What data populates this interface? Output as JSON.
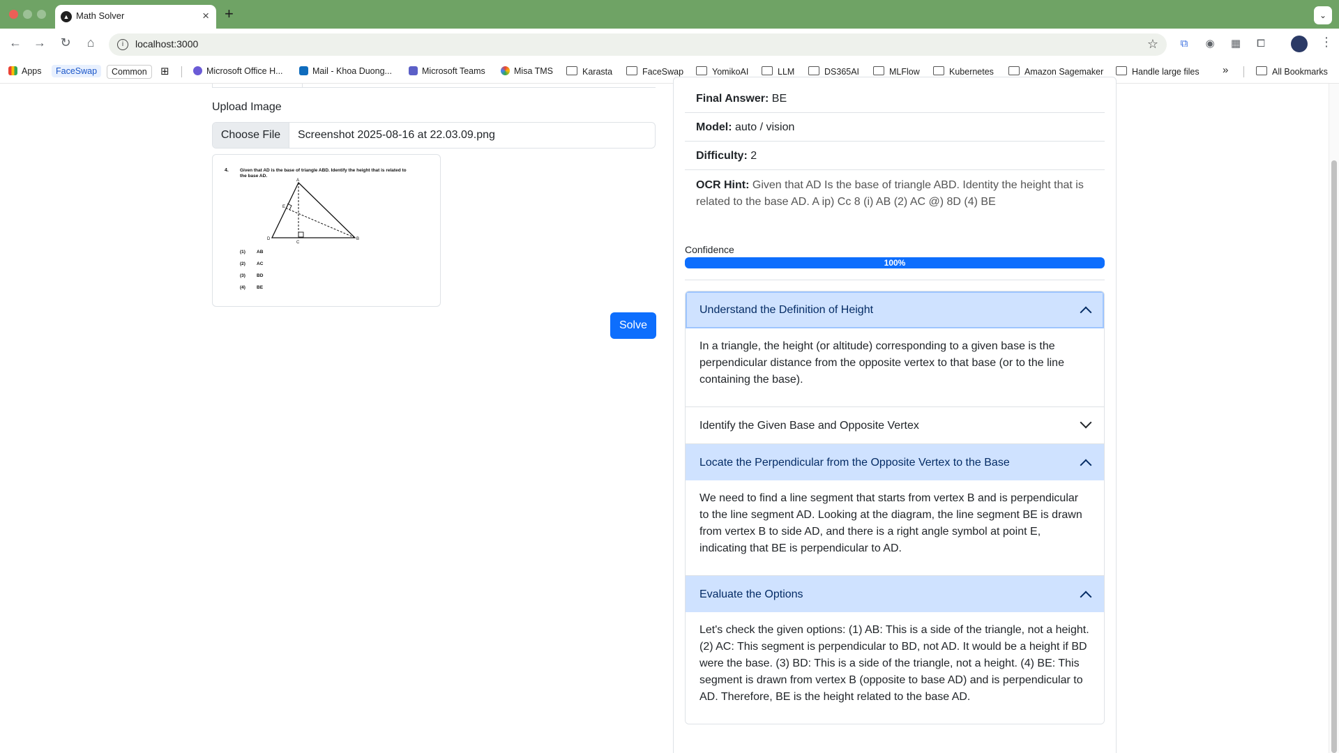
{
  "browser": {
    "tab_title": "Math Solver",
    "url": "localhost:3000",
    "bookmarks": [
      "Apps",
      "FaceSwap",
      "Common",
      "Microsoft Office H...",
      "Mail - Khoa Duong...",
      "Microsoft Teams",
      "Misa TMS",
      "Karasta",
      "FaceSwap",
      "YomikoAI",
      "LLM",
      "DS365AI",
      "MLFlow",
      "Kubernetes",
      "Amazon Sagemaker",
      "Handle large files"
    ],
    "all_bookmarks": "All Bookmarks",
    "overflow": "»"
  },
  "left": {
    "upload_label": "Upload Image",
    "choose_file": "Choose File",
    "file_name": "Screenshot 2025-08-16 at 22.03.09.png",
    "solve": "Solve",
    "preview": {
      "number": "4.",
      "question_line1": "Given that AD is the base of triangle ABD. Identify the height that is related to",
      "question_line2": "the base AD.",
      "labels": {
        "A": "A",
        "B": "B",
        "C": "C",
        "D": "D",
        "E": "E"
      },
      "options": [
        {
          "num": "(1)",
          "text": "AB"
        },
        {
          "num": "(2)",
          "text": "AC"
        },
        {
          "num": "(3)",
          "text": "BD"
        },
        {
          "num": "(4)",
          "text": "BE"
        }
      ]
    }
  },
  "result": {
    "final_answer_label": "Final Answer:",
    "final_answer": "BE",
    "model_label": "Model:",
    "model": "auto / vision",
    "difficulty_label": "Difficulty:",
    "difficulty": "2",
    "ocr_label": "OCR Hint:",
    "ocr_hint": "Given that AD Is the base of triangle ABD. Identity the height that is related to the base AD. A ip) Cc 8 (i) AB (2) AC @) 8D (4) BE",
    "confidence_label": "Confidence",
    "confidence_text": "100%",
    "confidence_value": 1.0
  },
  "steps": [
    {
      "title": "Understand the Definition of Height",
      "expanded": true,
      "body": "In a triangle, the height (or altitude) corresponding to a given base is the perpendicular distance from the opposite vertex to that base (or to the line containing the base)."
    },
    {
      "title": "Identify the Given Base and Opposite Vertex",
      "expanded": false,
      "body": ""
    },
    {
      "title": "Locate the Perpendicular from the Opposite Vertex to the Base",
      "expanded": true,
      "body": "We need to find a line segment that starts from vertex B and is perpendicular to the line segment AD. Looking at the diagram, the line segment BE is drawn from vertex B to side AD, and there is a right angle symbol at point E, indicating that BE is perpendicular to AD."
    },
    {
      "title": "Evaluate the Options",
      "expanded": true,
      "body": "Let's check the given options: (1) AB: This is a side of the triangle, not a height. (2) AC: This segment is perpendicular to BD, not AD. It would be a height if BD were the base. (3) BD: This is a side of the triangle, not a height. (4) BE: This segment is drawn from vertex B (opposite to base AD) and is perpendicular to AD. Therefore, BE is the height related to the base AD."
    }
  ],
  "colors": {
    "tabbar": "#6fa365",
    "primary": "#0d6efd",
    "accordion_open": "#cfe2ff"
  }
}
